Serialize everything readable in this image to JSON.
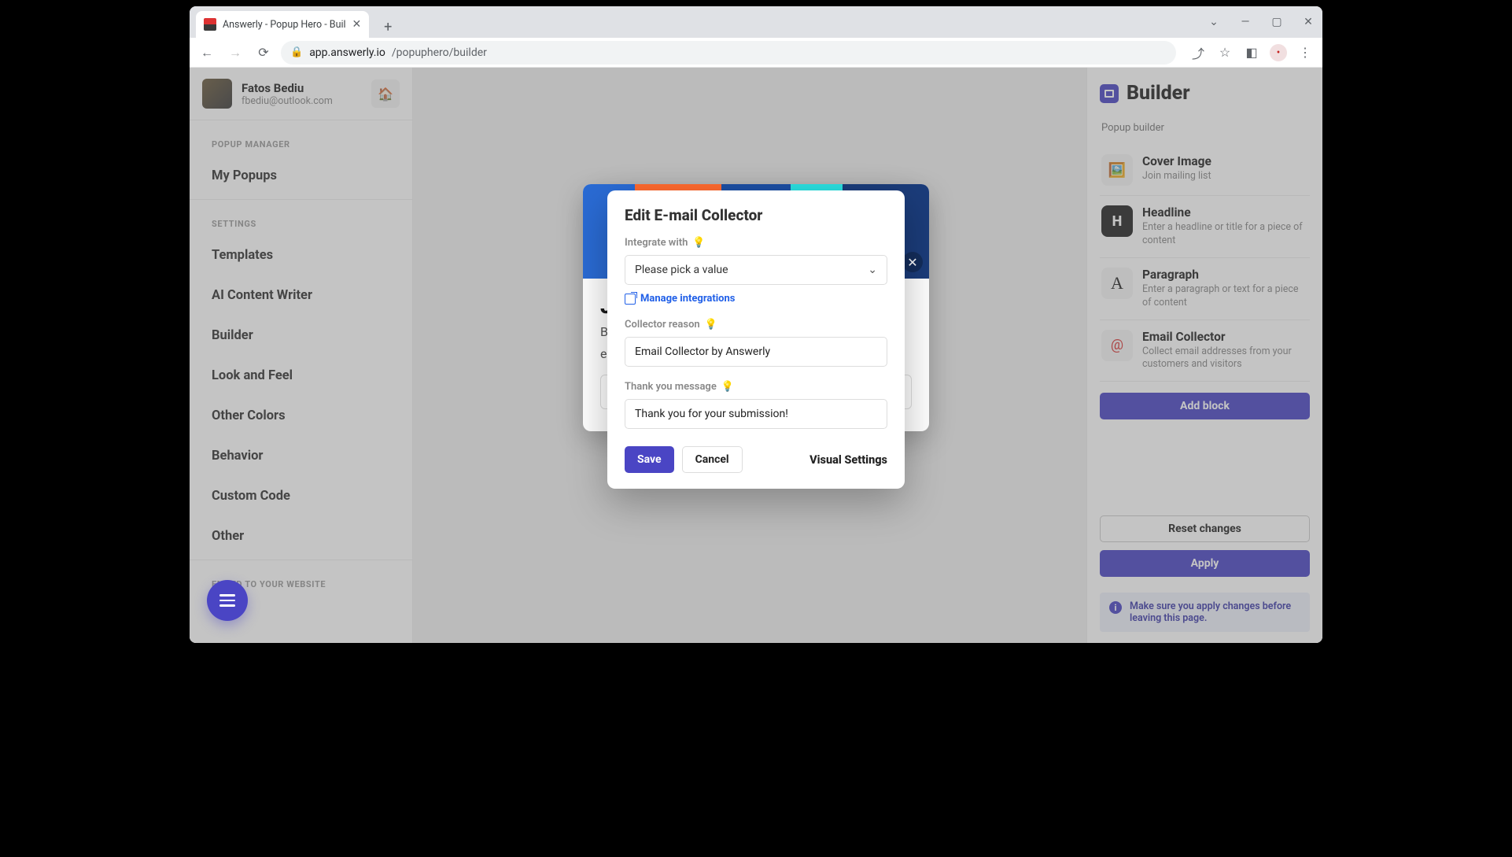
{
  "browser": {
    "tab_title": "Answerly - Popup Hero - Buil",
    "url_host": "app.answerly.io",
    "url_path": "/popuphero/builder"
  },
  "user": {
    "name": "Fatos Bediu",
    "email": "fbediu@outlook.com"
  },
  "sidebar": {
    "section_manager": "POPUP MANAGER",
    "my_popups": "My Popups",
    "section_settings": "SETTINGS",
    "templates": "Templates",
    "ai_writer": "AI Content Writer",
    "builder": "Builder",
    "look_feel": "Look and Feel",
    "other_colors": "Other Colors",
    "behavior": "Behavior",
    "custom_code": "Custom Code",
    "other": "Other",
    "section_embed": "EMBED TO YOUR WEBSITE"
  },
  "rightpanel": {
    "title": "Builder",
    "subtitle": "Popup builder",
    "blocks": {
      "cover": {
        "title": "Cover Image",
        "desc": "Join mailing list"
      },
      "headline": {
        "title": "Headline",
        "desc": "Enter a headline or title for a piece of content"
      },
      "paragraph": {
        "title": "Paragraph",
        "desc": "Enter a paragraph or text for a piece of content"
      },
      "email": {
        "title": "Email Collector",
        "desc": "Collect email addresses from your customers and visitors"
      }
    },
    "add_block": "Add block",
    "reset": "Reset changes",
    "apply": "Apply",
    "info": "Make sure you apply changes before leaving this page."
  },
  "modal": {
    "title": "Edit E-mail Collector",
    "integrate_label": "Integrate with",
    "integrate_placeholder": "Please pick a value",
    "manage_link": "Manage integrations",
    "reason_label": "Collector reason",
    "reason_value": "Email Collector by Answerly",
    "thanks_label": "Thank you message",
    "thanks_value": "Thank you for your submission!",
    "save": "Save",
    "cancel": "Cancel",
    "visual": "Visual Settings"
  },
  "preview": {
    "heading_initial": "J",
    "p_line1": "B",
    "p_line2": "e"
  }
}
